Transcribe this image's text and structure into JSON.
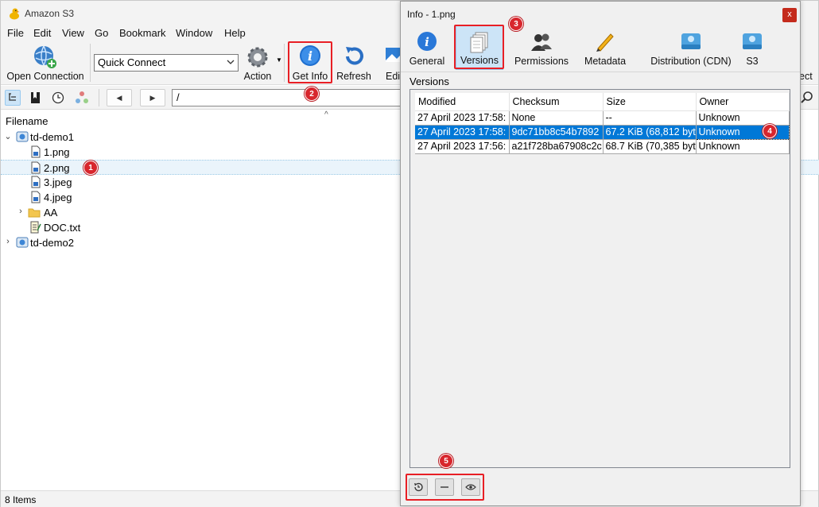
{
  "app": {
    "title": "Amazon S3"
  },
  "menu": [
    "File",
    "Edit",
    "View",
    "Go",
    "Bookmark",
    "Window",
    "Help"
  ],
  "toolbar": {
    "open_connection": "Open Connection",
    "quick_connect": "Quick Connect",
    "action": "Action",
    "get_info": "Get Info",
    "refresh": "Refresh",
    "edit": "Edi",
    "disconnect_partial": "ect"
  },
  "nav": {
    "path": "/"
  },
  "file_list": {
    "header": "Filename",
    "items": [
      {
        "name": "td-demo1",
        "type": "bucket",
        "expanded": true
      },
      {
        "name": "1.png",
        "type": "file"
      },
      {
        "name": "2.png",
        "type": "file",
        "selected": true
      },
      {
        "name": "3.jpeg",
        "type": "file"
      },
      {
        "name": "4.jpeg",
        "type": "file"
      },
      {
        "name": "AA",
        "type": "folder"
      },
      {
        "name": "DOC.txt",
        "type": "text"
      },
      {
        "name": "td-demo2",
        "type": "bucket",
        "expanded": false
      }
    ]
  },
  "status": {
    "items": "8 Items"
  },
  "dialog": {
    "title": "Info - 1.png",
    "close": "x",
    "tabs": [
      "General",
      "Versions",
      "Permissions",
      "Metadata",
      "Distribution (CDN)",
      "S3"
    ],
    "active_tab": "Versions",
    "section": "Versions",
    "columns": [
      "Modified",
      "Checksum",
      "Size",
      "Owner"
    ],
    "rows": [
      {
        "modified": "27 April 2023 17:58:",
        "checksum": "None",
        "size": "--",
        "owner": "Unknown"
      },
      {
        "modified": "27 April 2023 17:58:",
        "checksum": "9dc71bb8c54b7892",
        "size": "67.2 KiB (68,812 byt",
        "owner": "Unknown",
        "selected": true
      },
      {
        "modified": "27 April 2023 17:56:",
        "checksum": "a21f728ba67908c2c",
        "size": "68.7 KiB (70,385 byt",
        "owner": "Unknown"
      }
    ]
  },
  "annotations": {
    "badges": [
      "1",
      "2",
      "3",
      "4",
      "5"
    ],
    "color": "#e81f25"
  },
  "colors": {
    "selection": "#0078d7",
    "active_tab": "#cce4f7"
  }
}
